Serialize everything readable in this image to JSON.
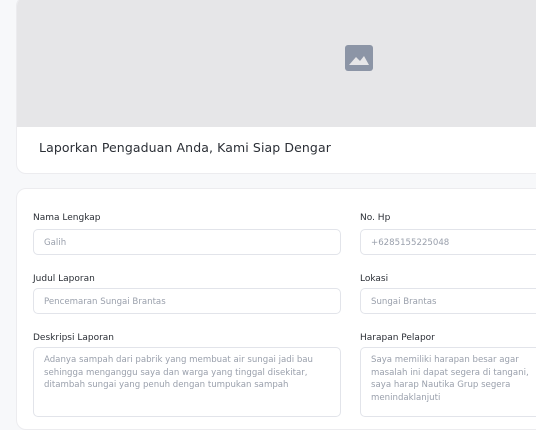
{
  "hero": {
    "image_icon": "image-placeholder-icon",
    "title": "Laporkan Pengaduan Anda, Kami Siap Dengar"
  },
  "form": {
    "nama": {
      "label": "Nama Lengkap",
      "value": "Galih"
    },
    "hp": {
      "label": "No. Hp",
      "value": "+6285155225048"
    },
    "judul": {
      "label": "Judul Laporan",
      "value": "Pencemaran Sungai Brantas"
    },
    "lokasi": {
      "label": "Lokasi",
      "value": "Sungai Brantas"
    },
    "deskripsi": {
      "label": "Deskripsi Laporan",
      "value": "Adanya sampah dari pabrik yang membuat air sungai jadi bau sehingga menganggu saya  dan warga yang tinggal disekitar, ditambah sungai yang penuh dengan tumpukan sampah"
    },
    "harapan": {
      "label": "Harapan Pelapor",
      "value": "Saya memiliki harapan besar agar masalah ini dapat segera di tangani, saya harap Nautika Grup segera menindaklanjuti"
    }
  }
}
